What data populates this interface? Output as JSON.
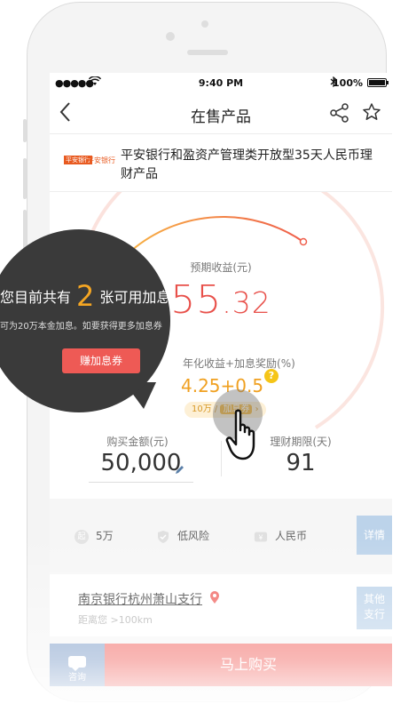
{
  "status_bar": {
    "signal": "●●●●●",
    "time": "9:40 PM",
    "battery": "100%"
  },
  "nav": {
    "title": "在售产品"
  },
  "product": {
    "name": "平安银行和盈资产管理类开放型35天人民币理财产品",
    "logo_text": "平安银行",
    "logo_sub": "PINGAN BANK"
  },
  "yield": {
    "label": "预期收益(元)",
    "value_int": "55",
    "value_dec": ".32",
    "rate_label": "年化收益+加息奖励(%)",
    "rate_value": "4.25+0.5",
    "help": "?",
    "coupon_amount": "10万",
    "coupon_tag": "加息券",
    "coupon_arrow": "›"
  },
  "purchase": {
    "amount_label": "购买金额(元)",
    "amount_value": "50,000",
    "term_label": "理财期限(天)",
    "term_value": "91"
  },
  "features": {
    "min_amount": "5万",
    "min_icon": "起",
    "risk": "低风险",
    "currency": "人民币",
    "detail_button": "详情"
  },
  "bank": {
    "name": "南京银行杭州萧山支行",
    "distance": "距离您 >100km",
    "other_button_line1": "其他",
    "other_button_line2": "支行"
  },
  "bottom": {
    "consult": "咨询",
    "buy": "马上购买"
  },
  "tooltip": {
    "line1_prefix": "您目前共有",
    "count": "2",
    "line1_suffix": "张可用加息券",
    "line2": "可为20万本金加息。如要获得更多加息券",
    "button": "赚加息券"
  },
  "colors": {
    "accent_red": "#f16560",
    "orange": "#f0a020",
    "blue_button": "#bcd3ea",
    "dark_tip": "#3a3a3a"
  }
}
